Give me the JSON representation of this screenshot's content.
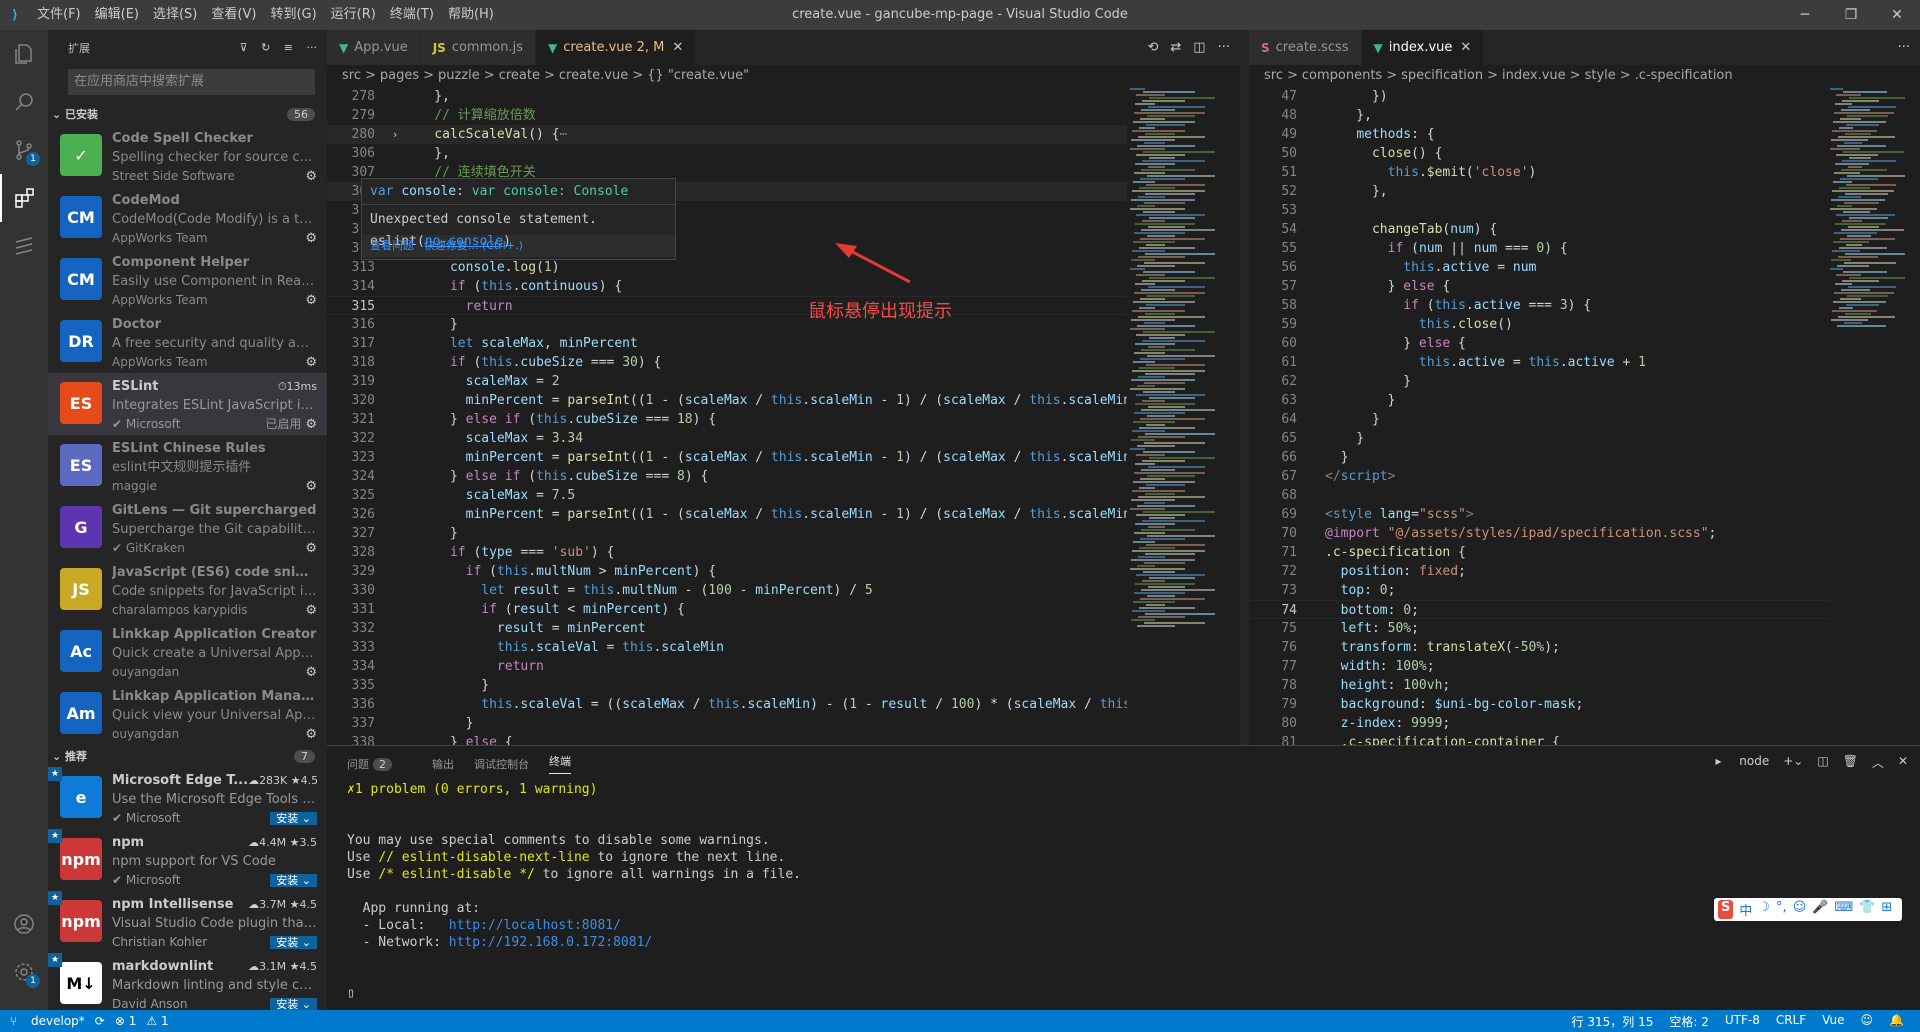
{
  "window": {
    "title": "create.vue - gancube-mp-page - Visual Studio Code",
    "menu": [
      "文件(F)",
      "编辑(E)",
      "选择(S)",
      "查看(V)",
      "转到(G)",
      "运行(R)",
      "终端(T)",
      "帮助(H)"
    ]
  },
  "sidebar": {
    "title": "扩展",
    "search_placeholder": "在应用商店中搜索扩展",
    "installed_label": "已安装",
    "installed_count": "56",
    "recommended_label": "推荐",
    "recommended_count": "7",
    "installed": [
      {
        "name": "Code Spell Checker",
        "desc": "Spelling checker for source code",
        "pub": "Street Side Software",
        "icon": "spell-check-icon",
        "color": "#4caf50",
        "glyph": "✓",
        "dim": true
      },
      {
        "name": "CodeMod",
        "desc": "CodeMod(Code Modify) is a too...",
        "pub": "AppWorks Team",
        "icon": "codemod-icon",
        "color": "#1565c0",
        "glyph": "CM",
        "dim": true
      },
      {
        "name": "Component Helper",
        "desc": "Easily use Component in React/...",
        "pub": "AppWorks Team",
        "icon": "component-helper-icon",
        "color": "#1565c0",
        "glyph": "CM",
        "dim": true
      },
      {
        "name": "Doctor",
        "desc": "A free security and quality audit ...",
        "pub": "AppWorks Team",
        "icon": "doctor-icon",
        "color": "#1565c0",
        "glyph": "DR",
        "dim": true
      },
      {
        "name": "ESLint",
        "desc": "Integrates ESLint JavaScript into ...",
        "pub": "Microsoft",
        "icon": "eslint-icon",
        "color": "#e64a19",
        "glyph": "ES",
        "dim": false,
        "time": "13ms",
        "status": "已启用",
        "sel": true
      },
      {
        "name": "ESLint Chinese Rules",
        "desc": "eslint中文规则提示插件",
        "pub": "maggie",
        "icon": "eslint-chinese-icon",
        "color": "#5c6bc0",
        "glyph": "ES",
        "dim": true
      },
      {
        "name": "GitLens — Git supercharged",
        "desc": "Supercharge the Git capabilities ...",
        "pub": "GitKraken",
        "icon": "gitlens-icon",
        "color": "#5e35b1",
        "glyph": "G",
        "dim": true
      },
      {
        "name": "JavaScript (ES6) code snippets",
        "desc": "Code snippets for JavaScript in E...",
        "pub": "charalampos karypidis",
        "icon": "js-snippets-icon",
        "color": "#c9a825",
        "glyph": "JS",
        "dim": true
      },
      {
        "name": "Linkkap Application Creator",
        "desc": "Quick create a Universal Applica...",
        "pub": "ouyangdan",
        "icon": "linkkap-creator-icon",
        "color": "#1565c0",
        "glyph": "Ac",
        "dim": true
      },
      {
        "name": "Linkkap Application Manager",
        "desc": "Quick view your Universal Appli...",
        "pub": "ouyangdan",
        "icon": "linkkap-manager-icon",
        "color": "#1565c0",
        "glyph": "Am",
        "dim": true
      }
    ],
    "recommended": [
      {
        "name": "Microsoft Edge T...",
        "desc": "Use the Microsoft Edge Tools fr...",
        "pub": "Microsoft",
        "icon": "edge-icon",
        "color": "#0f7bd7",
        "glyph": "e",
        "downloads": "283K",
        "rating": "4.5"
      },
      {
        "name": "npm",
        "desc": "npm support for VS Code",
        "pub": "Microsoft",
        "icon": "npm-icon",
        "color": "#cb3837",
        "glyph": "npm",
        "downloads": "4.4M",
        "rating": "3.5"
      },
      {
        "name": "npm Intellisense",
        "desc": "Visual Studio Code plugin that a...",
        "pub": "Christian Kohler",
        "icon": "npm-intellisense-icon",
        "color": "#cb3837",
        "glyph": "npm",
        "downloads": "3.7M",
        "rating": "4.5"
      },
      {
        "name": "markdownlint",
        "desc": "Markdown linting and style chec...",
        "pub": "David Anson",
        "icon": "markdownlint-icon",
        "color": "#ffffff",
        "glyph": "M↓",
        "downloads": "3.1M",
        "rating": "4.5"
      }
    ],
    "install_label": "安装"
  },
  "editorL": {
    "tabs": [
      {
        "label": "App.vue",
        "icon": "vue-icon",
        "color": "#41b883",
        "glyph": "▼"
      },
      {
        "label": "common.js",
        "icon": "js-icon",
        "color": "#cbcb41",
        "glyph": "JS"
      },
      {
        "label": "create.vue",
        "suffix": "2, M",
        "icon": "vue-icon",
        "color": "#41b883",
        "glyph": "▼",
        "active": true,
        "modified": true
      }
    ],
    "crumbs": [
      "src",
      ">",
      "pages",
      ">",
      "puzzle",
      ">",
      "create",
      ">",
      "create.vue",
      ">",
      "{} \"create.vue\""
    ],
    "lines": [
      {
        "n": "278",
        "h": "    },"
      },
      {
        "n": "279",
        "h": "    <span class='c'>// 计算缩放倍数</span>"
      },
      {
        "n": "280",
        "h": "    <span class='f'>calcScaleVal</span>() {<span class='tg'>⋯</span>",
        "fold": "›",
        "hl": true
      },
      {
        "n": "306",
        "h": "    },"
      },
      {
        "n": "307",
        "h": "    <span class='c'>// 连续填色开关</span>"
      },
      {
        "n": "308",
        "h": "    ch",
        "fold": "›",
        "hl": true
      },
      {
        "n": "310",
        "h": "    },"
      },
      {
        "n": "311",
        "h": "    //"
      },
      {
        "n": "312",
        "h": "    sc"
      },
      {
        "n": "313",
        "h": "      <span class='v'>console</span>.<span class='f'>log</span>(<span class='n'>1</span>)"
      },
      {
        "n": "314",
        "h": "      <span class='kc'>if</span> (<span class='k'>this</span>.<span class='v'>continuous</span>) {"
      },
      {
        "n": "315",
        "h": "        <span class='kc'>return</span>",
        "cur": true
      },
      {
        "n": "316",
        "h": "      }"
      },
      {
        "n": "317",
        "h": "      <span class='k'>let</span> <span class='v'>scaleMax</span>, <span class='v'>minPercent</span>"
      },
      {
        "n": "318",
        "h": "      <span class='kc'>if</span> (<span class='k'>this</span>.<span class='v'>cubeSize</span> === <span class='n'>30</span>) {"
      },
      {
        "n": "319",
        "h": "        <span class='v'>scaleMax</span> = <span class='n'>2</span>"
      },
      {
        "n": "320",
        "h": "        <span class='v'>minPercent</span> = <span class='f'>parseInt</span>((<span class='n'>1</span> - (<span class='v'>scaleMax</span> / <span class='k'>this</span>.<span class='v'>scaleMin</span> - <span class='n'>1</span>) / (<span class='v'>scaleMax</span> / <span class='k'>this</span>.<span class='v'>scaleMin</span>))"
      },
      {
        "n": "321",
        "h": "      } <span class='kc'>else if</span> (<span class='k'>this</span>.<span class='v'>cubeSize</span> === <span class='n'>18</span>) {"
      },
      {
        "n": "322",
        "h": "        <span class='v'>scaleMax</span> = <span class='n'>3.34</span>"
      },
      {
        "n": "323",
        "h": "        <span class='v'>minPercent</span> = <span class='f'>parseInt</span>((<span class='n'>1</span> - (<span class='v'>scaleMax</span> / <span class='k'>this</span>.<span class='v'>scaleMin</span> - <span class='n'>1</span>) / (<span class='v'>scaleMax</span> / <span class='k'>this</span>.<span class='v'>scaleMin</span>))"
      },
      {
        "n": "324",
        "h": "      } <span class='kc'>else if</span> (<span class='k'>this</span>.<span class='v'>cubeSize</span> === <span class='n'>8</span>) {"
      },
      {
        "n": "325",
        "h": "        <span class='v'>scaleMax</span> = <span class='n'>7.5</span>"
      },
      {
        "n": "326",
        "h": "        <span class='v'>minPercent</span> = <span class='f'>parseInt</span>((<span class='n'>1</span> - (<span class='v'>scaleMax</span> / <span class='k'>this</span>.<span class='v'>scaleMin</span> - <span class='n'>1</span>) / (<span class='v'>scaleMax</span> / <span class='k'>this</span>.<span class='v'>scaleMin</span>))"
      },
      {
        "n": "327",
        "h": "      }"
      },
      {
        "n": "328",
        "h": "      <span class='kc'>if</span> (<span class='v'>type</span> === <span class='s'>'sub'</span>) {"
      },
      {
        "n": "329",
        "h": "        <span class='kc'>if</span> (<span class='k'>this</span>.<span class='v'>multNum</span> &gt; <span class='v'>minPercent</span>) {"
      },
      {
        "n": "330",
        "h": "          <span class='k'>let</span> <span class='v'>result</span> = <span class='k'>this</span>.<span class='v'>multNum</span> - (<span class='n'>100</span> - <span class='v'>minPercent</span>) / <span class='n'>5</span>"
      },
      {
        "n": "331",
        "h": "          <span class='kc'>if</span> (<span class='v'>result</span> &lt; <span class='v'>minPercent</span>) {"
      },
      {
        "n": "332",
        "h": "            <span class='v'>result</span> = <span class='v'>minPercent</span>"
      },
      {
        "n": "333",
        "h": "            <span class='k'>this</span>.<span class='v'>scaleVal</span> = <span class='k'>this</span>.<span class='v'>scaleMin</span>"
      },
      {
        "n": "334",
        "h": "            <span class='kc'>return</span>"
      },
      {
        "n": "335",
        "h": "          }"
      },
      {
        "n": "336",
        "h": "          <span class='k'>this</span>.<span class='v'>scaleVal</span> = ((<span class='v'>scaleMax</span> / <span class='k'>this</span>.<span class='v'>scaleMin</span>) - (<span class='n'>1</span> - <span class='v'>result</span> / <span class='n'>100</span>) * (<span class='v'>scaleMax</span> / <span class='k'>this</span>.<span class='v'>sc</span>"
      },
      {
        "n": "337",
        "h": "        }"
      },
      {
        "n": "338",
        "h": "      } <span class='kc'>else</span> {"
      }
    ]
  },
  "editorR": {
    "tabs": [
      {
        "label": "create.scss",
        "icon": "scss-icon",
        "color": "#cd6799",
        "glyph": "S"
      },
      {
        "label": "index.vue",
        "icon": "vue-icon",
        "color": "#41b883",
        "glyph": "▼",
        "active": true
      }
    ],
    "crumbs": [
      "src",
      ">",
      "components",
      ">",
      "specification",
      ">",
      "index.vue",
      ">",
      "style",
      ">",
      ".c-specification"
    ],
    "lines": [
      {
        "n": "47",
        "h": "      })"
      },
      {
        "n": "48",
        "h": "    },"
      },
      {
        "n": "49",
        "h": "    <span class='v'>methods</span>: {"
      },
      {
        "n": "50",
        "h": "      <span class='f'>close</span>() {"
      },
      {
        "n": "51",
        "h": "        <span class='k'>this</span>.<span class='f'>$emit</span>(<span class='s'>'close'</span>)"
      },
      {
        "n": "52",
        "h": "      },"
      },
      {
        "n": "53",
        "h": ""
      },
      {
        "n": "54",
        "h": "      <span class='f'>changeTab</span>(<span class='v'>num</span>) {"
      },
      {
        "n": "55",
        "h": "        <span class='kc'>if</span> (<span class='v'>num</span> || <span class='v'>num</span> === <span class='n'>0</span>) {"
      },
      {
        "n": "56",
        "h": "          <span class='k'>this</span>.<span class='v'>active</span> = <span class='v'>num</span>"
      },
      {
        "n": "57",
        "h": "        } <span class='kc'>else</span> {"
      },
      {
        "n": "58",
        "h": "          <span class='kc'>if</span> (<span class='k'>this</span>.<span class='v'>active</span> === <span class='n'>3</span>) {"
      },
      {
        "n": "59",
        "h": "            <span class='k'>this</span>.<span class='f'>close</span>()"
      },
      {
        "n": "60",
        "h": "          } <span class='kc'>else</span> {"
      },
      {
        "n": "61",
        "h": "            <span class='k'>this</span>.<span class='v'>active</span> = <span class='k'>this</span>.<span class='v'>active</span> + <span class='n'>1</span>"
      },
      {
        "n": "62",
        "h": "          }"
      },
      {
        "n": "63",
        "h": "        }"
      },
      {
        "n": "64",
        "h": "      }"
      },
      {
        "n": "65",
        "h": "    }"
      },
      {
        "n": "66",
        "h": "  }"
      },
      {
        "n": "67",
        "h": "<span class='tg'>&lt;/</span><span class='k'>script</span><span class='tg'>&gt;</span>"
      },
      {
        "n": "68",
        "h": ""
      },
      {
        "n": "69",
        "h": "<span class='tg'>&lt;</span><span class='k'>style</span> <span class='v'>lang</span>=<span class='s'>\"scss\"</span><span class='tg'>&gt;</span>"
      },
      {
        "n": "70",
        "h": "<span class='kc'>@import</span> <span class='s'>\"@/assets/styles/ipad/specification.scss\"</span>;"
      },
      {
        "n": "71",
        "h": "<span class='f'>.c-specification</span> {"
      },
      {
        "n": "72",
        "h": "  <span class='v'>position</span>: <span class='s'>fixed</span>;"
      },
      {
        "n": "73",
        "h": "  <span class='v'>top</span>: <span class='n'>0</span>;"
      },
      {
        "n": "74",
        "h": "  <span class='v'>bottom</span>: <span class='n'>0</span>;",
        "cur": true
      },
      {
        "n": "75",
        "h": "  <span class='v'>left</span>: <span class='n'>50%</span>;"
      },
      {
        "n": "76",
        "h": "  <span class='v'>transform</span>: <span class='f'>translateX</span>(<span class='n'>-50%</span>);"
      },
      {
        "n": "77",
        "h": "  <span class='v'>width</span>: <span class='n'>100%</span>;"
      },
      {
        "n": "78",
        "h": "  <span class='v'>height</span>: <span class='n'>100vh</span>;"
      },
      {
        "n": "79",
        "h": "  <span class='v'>background</span>: <span class='v'>$uni-bg-color-mask</span>;"
      },
      {
        "n": "80",
        "h": "  <span class='v'>z-index</span>: <span class='n'>9999</span>;"
      },
      {
        "n": "81",
        "h": "  <span class='f'>.c-specification-container</span> {"
      }
    ]
  },
  "hover": {
    "sig": "var console: Console",
    "msg": "Unexpected console statement. eslint(",
    "rule": "no-console",
    "msg_end": ")",
    "view_problem": "查看问题",
    "quick_fix": "快速修复... (Ctrl+.)"
  },
  "annotation": "鼠标悬停出现提示",
  "panel": {
    "tabs": [
      "问题",
      "输出",
      "调试控制台",
      "终端"
    ],
    "problems_count": "2",
    "terminal_name": "node",
    "lines": [
      {
        "t": "<span class='ty'>✗1 problem (0 errors, 1 warning)</span>"
      },
      {
        "t": ""
      },
      {
        "t": ""
      },
      {
        "t": "You may use special comments to disable some warnings."
      },
      {
        "t": "Use <span class='ty'>// eslint-disable-next-line</span> to ignore the next line."
      },
      {
        "t": "Use <span class='ty'>/* eslint-disable */</span> to ignore all warnings in a file."
      },
      {
        "t": ""
      },
      {
        "t": "  App running at:"
      },
      {
        "t": "  - Local:   <span class='tb'>http://localhost:8081/</span>"
      },
      {
        "t": "  - Network: <span class='tb'>http://192.168.0.172:8081/</span>"
      },
      {
        "t": ""
      },
      {
        "t": ""
      },
      {
        "t": "▯"
      }
    ]
  },
  "status": {
    "branch": "develop*",
    "sync": "⟳",
    "errors": "⊗ 1",
    "warnings": "⚠ 1",
    "position": "行 315，列 15",
    "spaces": "空格: 2",
    "encoding": "UTF-8",
    "eol": "CRLF",
    "lang": "Vue"
  },
  "ime": [
    "S",
    "中",
    "☽",
    "°,",
    "☺",
    "🎤",
    "⌨",
    "👕",
    "⊞"
  ]
}
